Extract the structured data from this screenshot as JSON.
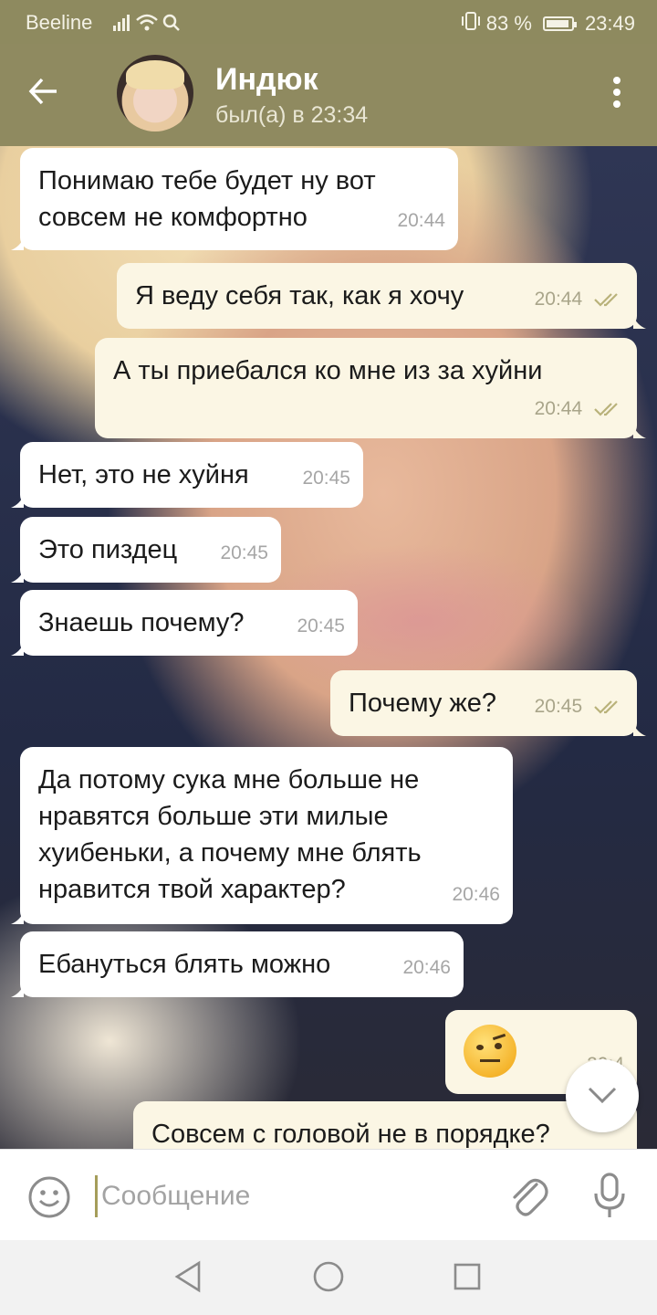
{
  "status_bar": {
    "carrier": "Beeline",
    "signal_text": ".ııl",
    "battery_percent": "83 %",
    "time": "23:49"
  },
  "header": {
    "contact_name": "Индюк",
    "last_seen": "был(а) в 23:34"
  },
  "messages": [
    {
      "dir": "in",
      "text": "Понимаю тебе будет ну вот\nсовсем не комфортно",
      "time": "20:44"
    },
    {
      "dir": "out",
      "text": "Я веду себя так, как я хочу",
      "time": "20:44",
      "read": true
    },
    {
      "dir": "out",
      "text": "А ты приебался ко мне из за хуйни",
      "time": "20:44",
      "read": true
    },
    {
      "dir": "in",
      "text": "Нет, это не хуйня",
      "time": "20:45"
    },
    {
      "dir": "in",
      "text": "Это пиздец",
      "time": "20:45"
    },
    {
      "dir": "in",
      "text": "Знаешь почему?",
      "time": "20:45"
    },
    {
      "dir": "out",
      "text": "Почему же?",
      "time": "20:45",
      "read": true
    },
    {
      "dir": "in",
      "text": "Да потому сука мне больше не\nнравятся больше эти милые\nхуибеньки, а почему мне блять\nнравится твой характер?",
      "time": "20:46"
    },
    {
      "dir": "in",
      "text": "Ебануться блять можно",
      "time": "20:46"
    },
    {
      "dir": "out",
      "emoji": "face-with-raised-eyebrow",
      "time": "20:4"
    },
    {
      "dir": "out",
      "text": "Совсем с головой не в порядке?",
      "time": ""
    }
  ],
  "composer": {
    "placeholder": "Сообщение"
  },
  "colors": {
    "header_bg": "#8f8a60",
    "incoming_bubble": "#ffffff",
    "outgoing_bubble": "#fbf6e4",
    "read_check": "#b9b27a"
  },
  "icons": {
    "back": "arrow-left-icon",
    "menu": "more-vertical-icon",
    "scroll": "chevron-down-icon",
    "emoji": "smile-icon",
    "attach": "paperclip-icon",
    "mic": "microphone-icon"
  }
}
